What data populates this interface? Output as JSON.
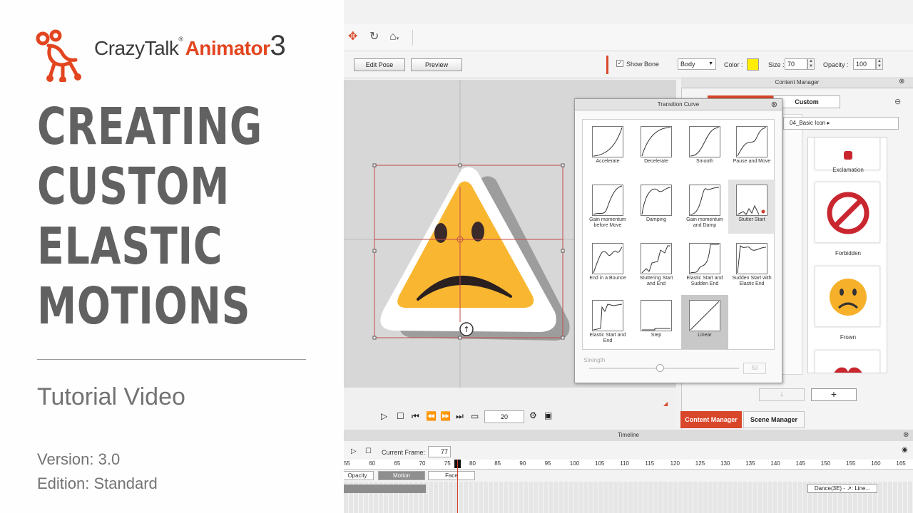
{
  "colors": {
    "accent": "#d9472b",
    "brand_orange": "#e2451f",
    "title_gray": "#616161",
    "face_yellow": "#f9b731",
    "color_swatch": "#ffee00"
  },
  "toolbar2": {
    "edit_pose": "Edit Pose",
    "preview": "Preview",
    "show_bone": "Show Bone",
    "body_select": "Body",
    "color_label": "Color :",
    "size_label": "Size :",
    "size_value": "70",
    "opacity_label": "Opacity :",
    "opacity_value": "100"
  },
  "content_manager": {
    "title": "Content Manager",
    "tab_custom": "Custom",
    "path": "04_Basic Icon ▸",
    "items": [
      "Exclamation",
      "Forbidden",
      "Frown"
    ],
    "tabs": [
      "Content Manager",
      "Scene Manager"
    ],
    "add": "+",
    "down": "↓"
  },
  "transition_curve": {
    "title": "Transition Curve",
    "strength_label": "Strength",
    "strength_value": "50",
    "curves": [
      [
        "Accelerate"
      ],
      [
        "Decelerate"
      ],
      [
        "Smooth"
      ],
      [
        "Pause and Move"
      ],
      [
        "Gain momentum",
        "before Move"
      ],
      [
        "Damping"
      ],
      [
        "Gain momentum",
        "and Damp"
      ],
      [
        "Stutter Start"
      ],
      [
        "End in a Bounce"
      ],
      [
        "Stuttering Start",
        "and End"
      ],
      [
        "Elastic Start and",
        "Sudden End"
      ],
      [
        "Sudden Start with",
        "Elastic End"
      ],
      [
        "Elastic Start and",
        "End"
      ],
      [
        "Step"
      ],
      [
        "Linear"
      ]
    ]
  },
  "playback": {
    "frame_value": "20"
  },
  "timeline": {
    "title": "Timeline",
    "current_frame_label": "Current Frame:",
    "current_frame": "77",
    "ticks": [
      "55",
      "60",
      "65",
      "70",
      "75",
      "80",
      "85",
      "90",
      "95",
      "100",
      "105",
      "110",
      "115",
      "120",
      "125",
      "130",
      "135",
      "140",
      "145",
      "150",
      "155",
      "160",
      "165"
    ],
    "tracks": [
      "Opacity",
      "Motion",
      "Face"
    ],
    "clip": "Dance(3E) - ↗: Line..."
  },
  "overlay": {
    "logo_word_a": "CrazyTalk",
    "logo_reg": "®",
    "logo_word_b": "Animator",
    "logo_num": "3",
    "title_lines": [
      "CREATING",
      "CUSTOM",
      "ELASTIC",
      "MOTIONS"
    ],
    "subtitle": "Tutorial Video",
    "version": "Version: 3.0",
    "edition": "Edition: Standard"
  }
}
